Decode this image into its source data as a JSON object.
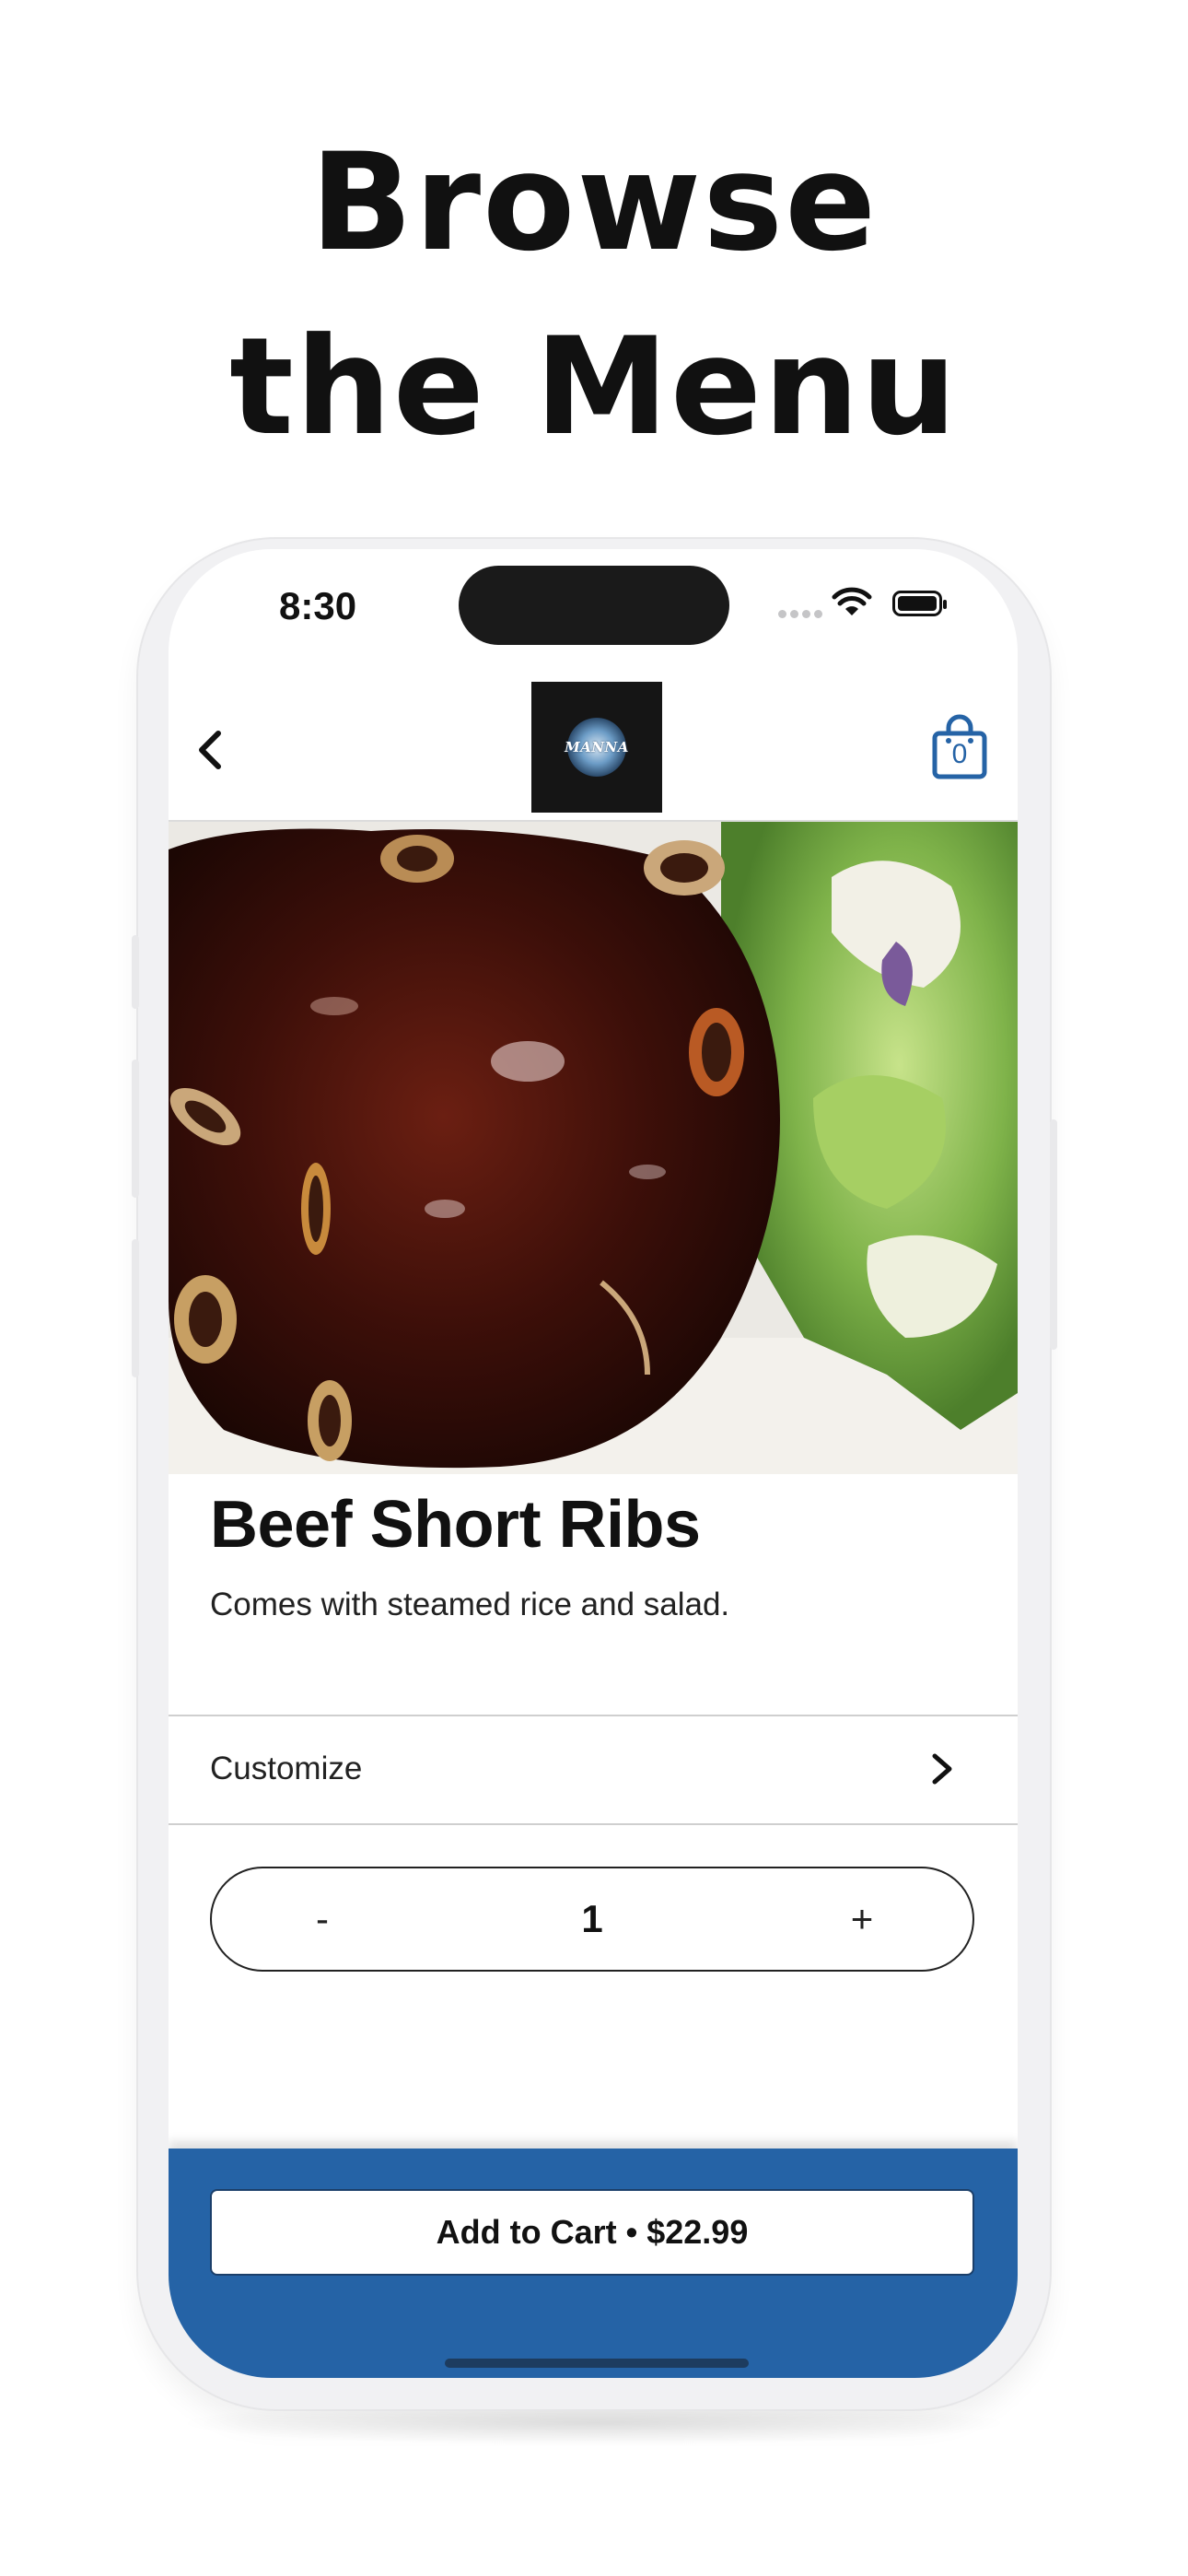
{
  "headline": {
    "line1": "Browse",
    "line2": "the Menu"
  },
  "status_bar": {
    "time": "8:30"
  },
  "nav": {
    "back_icon": "chevron-left-icon",
    "logo_text": "MANNA",
    "cart_count": "0",
    "cart_icon": "shopping-bag-icon"
  },
  "item": {
    "image_alt": "Beef Short Ribs photo",
    "title": "Beef Short Ribs",
    "description": "Comes with steamed rice and salad."
  },
  "customize": {
    "label": "Customize"
  },
  "quantity": {
    "minus_label": "-",
    "value": "1",
    "plus_label": "+"
  },
  "cart_button": {
    "label": "Add to Cart • $22.99"
  },
  "colors": {
    "brand_blue": "#2563a6",
    "text": "#111111",
    "logo_bg": "#151515"
  }
}
